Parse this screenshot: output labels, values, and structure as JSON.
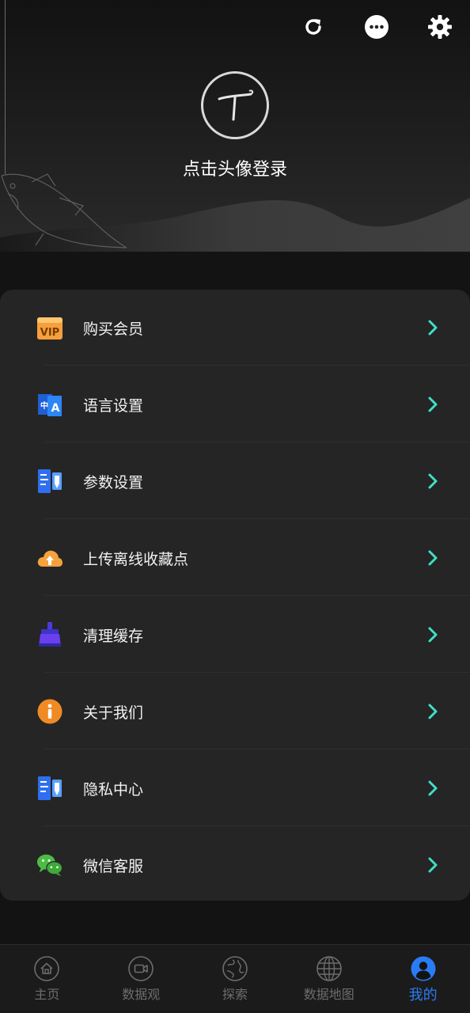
{
  "header": {
    "login_prompt": "点击头像登录",
    "icons": [
      "refresh-icon",
      "more-icon",
      "settings-icon"
    ]
  },
  "menu": {
    "items": [
      {
        "label": "购买会员",
        "icon": "vip-icon"
      },
      {
        "label": "语言设置",
        "icon": "language-icon"
      },
      {
        "label": "参数设置",
        "icon": "parameters-icon"
      },
      {
        "label": "上传离线收藏点",
        "icon": "cloud-upload-icon"
      },
      {
        "label": "清理缓存",
        "icon": "broom-icon"
      },
      {
        "label": "关于我们",
        "icon": "info-icon"
      },
      {
        "label": "隐私中心",
        "icon": "privacy-icon"
      },
      {
        "label": "微信客服",
        "icon": "wechat-icon"
      }
    ]
  },
  "tabbar": {
    "tabs": [
      {
        "label": "主页",
        "icon": "home-icon",
        "active": false
      },
      {
        "label": "数据观",
        "icon": "video-icon",
        "active": false
      },
      {
        "label": "探索",
        "icon": "globe-icon",
        "active": false
      },
      {
        "label": "数据地图",
        "icon": "world-grid-icon",
        "active": false
      },
      {
        "label": "我的",
        "icon": "profile-icon",
        "active": true
      }
    ]
  },
  "colors": {
    "accent_chevron": "#3fe0c5",
    "active_tab": "#2a7cf4",
    "vip_orange": "#f5a03c",
    "blue_icon": "#2d6ff0",
    "wechat_green": "#4cbc47"
  }
}
